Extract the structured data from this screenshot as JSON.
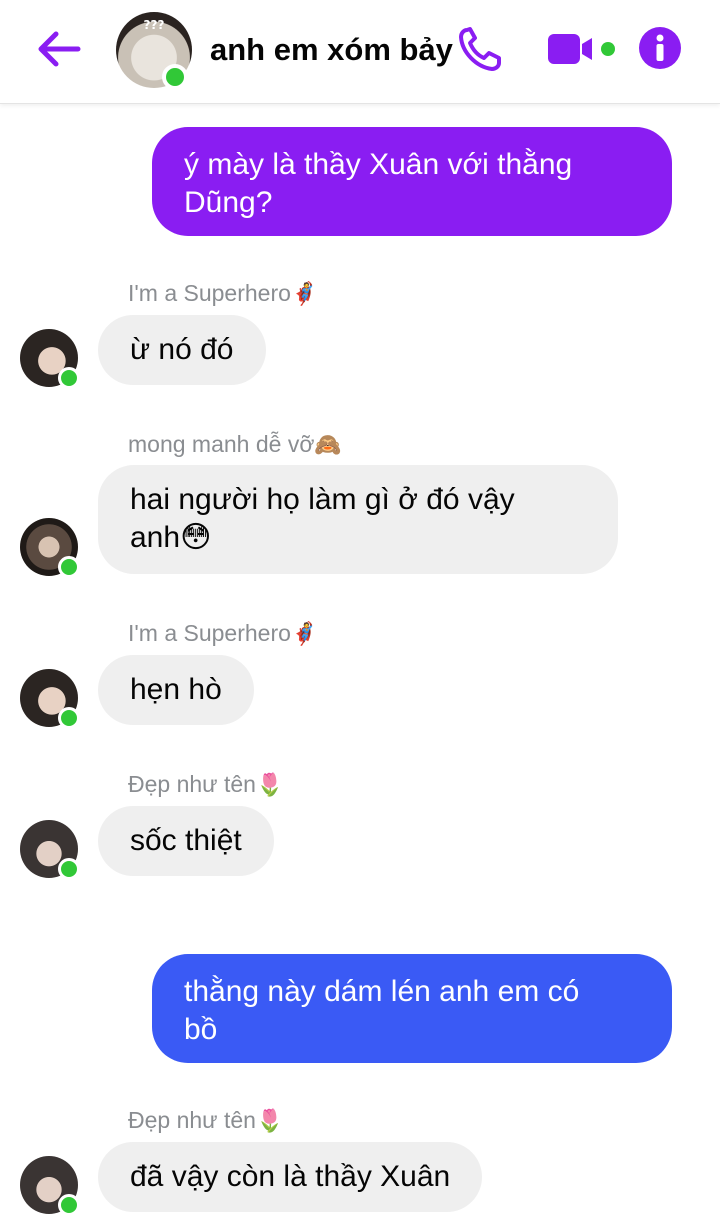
{
  "header": {
    "title": "anh em xóm bảy",
    "avatar_badge": "???",
    "icons": [
      "back-arrow-icon",
      "phone-icon",
      "video-camera-icon",
      "info-icon"
    ],
    "accent_color": "#8a1df2"
  },
  "messages": [
    {
      "direction": "outgoing",
      "text_line1": "ý mày là thầy Xuân với thằng",
      "text_line2": "Dũng?",
      "bubble_color": "#8a1df2"
    },
    {
      "direction": "incoming",
      "sender": "I'm a Superhero",
      "sender_emoji": "🦸",
      "text": "ừ nó đó"
    },
    {
      "direction": "incoming",
      "sender": "mong manh dễ vỡ",
      "sender_emoji": "🙈",
      "text_line1": "hai người họ làm gì ở đó vậy",
      "text_line2": "anh",
      "text_emoji": "😳"
    },
    {
      "direction": "incoming",
      "sender": "I'm a Superhero",
      "sender_emoji": "🦸",
      "text": "hẹn hò"
    },
    {
      "direction": "incoming",
      "sender": "Đẹp như tên",
      "sender_emoji": "🌷",
      "text": "sốc thiệt"
    },
    {
      "direction": "outgoing",
      "text_line1": "thằng này dám lén anh em có",
      "text_line2": "bồ",
      "bubble_color": "#3a5af5"
    },
    {
      "direction": "incoming",
      "sender": "Đẹp như tên",
      "sender_emoji": "🌷",
      "text": "đã vậy còn là thầy Xuân"
    }
  ],
  "colors": {
    "online": "#31c837",
    "incoming_bubble": "#efefef",
    "sender_name": "#8a8d91"
  }
}
